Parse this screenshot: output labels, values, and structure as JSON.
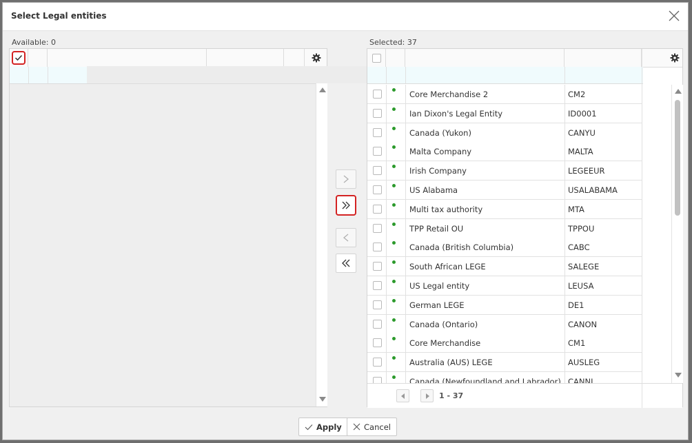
{
  "dialog": {
    "title": "Select Legal entities"
  },
  "available": {
    "label": "Available: 0"
  },
  "selected": {
    "label": "Selected: 37",
    "rows": [
      {
        "name": "Core Merchandise 2",
        "code": "CM2"
      },
      {
        "name": "Ian Dixon's Legal Entity",
        "code": "ID0001"
      },
      {
        "name": "Canada (Yukon)",
        "code": "CANYU"
      },
      {
        "name": "Malta Company",
        "code": "MALTA"
      },
      {
        "name": "Irish Company",
        "code": "LEGEEUR"
      },
      {
        "name": "US Alabama",
        "code": "USALABAMA"
      },
      {
        "name": "Multi tax authority",
        "code": "MTA"
      },
      {
        "name": "TPP Retail OU",
        "code": "TPPOU"
      },
      {
        "name": "Canada (British Columbia)",
        "code": "CABC"
      },
      {
        "name": "South African LEGE",
        "code": "SALEGE"
      },
      {
        "name": "US Legal entity",
        "code": "LEUSA"
      },
      {
        "name": "German LEGE",
        "code": "DE1"
      },
      {
        "name": "Canada (Ontario)",
        "code": "CANON"
      },
      {
        "name": "Core Merchandise",
        "code": "CM1"
      },
      {
        "name": "Australia (AUS) LEGE",
        "code": "AUSLEG"
      },
      {
        "name": "Canada (Newfoundland and Labrador)",
        "code": "CANNL"
      }
    ],
    "pager": {
      "range": "1 - 37"
    }
  },
  "footer": {
    "apply_label": "Apply",
    "cancel_label": "Cancel"
  },
  "colors": {
    "accent_highlight": "#d32222",
    "status_dot": "#2c9a2c",
    "filter_row": "#f0fbfd"
  },
  "icons": {
    "close": "close-icon",
    "settings": "gear-icon",
    "move_one_right": "chevron-right-icon",
    "move_all_right": "double-chevron-right-icon",
    "move_one_left": "chevron-left-icon",
    "move_all_left": "double-chevron-left-icon"
  }
}
